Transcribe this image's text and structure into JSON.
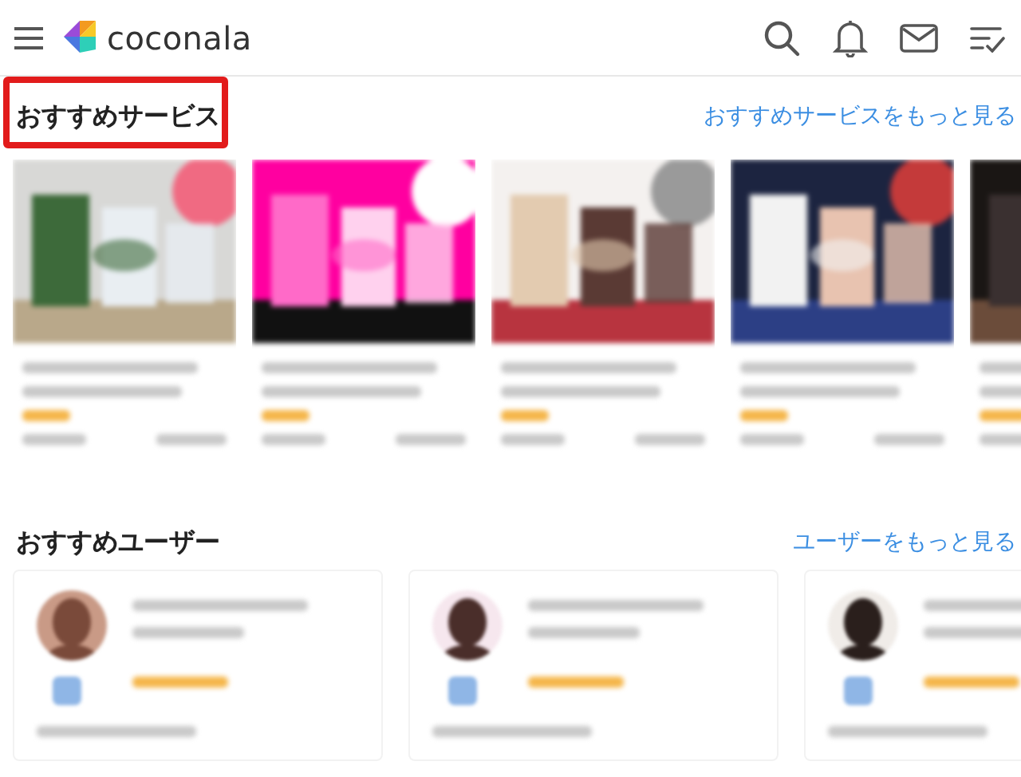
{
  "header": {
    "logo": "coconala"
  },
  "services": {
    "title": "おすすめサービス",
    "highlighted": true,
    "more_link": "おすすめサービスをもっと見る"
  },
  "users": {
    "title": "おすすめユーザー",
    "more_link": "ユーザーをもっと見る"
  }
}
